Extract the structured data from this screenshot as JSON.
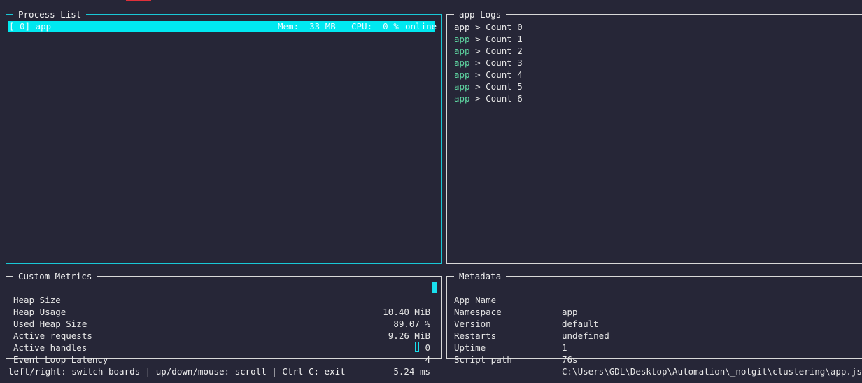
{
  "process_list": {
    "title": "Process List",
    "rows": [
      {
        "id": "[ 0] app",
        "mem": "Mem:  33 MB",
        "cpu": "CPU:  0 %",
        "status": "online"
      }
    ]
  },
  "logs": {
    "title": "app Logs",
    "lines": [
      {
        "app": "app",
        "text": " > Count 0"
      },
      {
        "app": "app",
        "text": " > Count 1"
      },
      {
        "app": "app",
        "text": " > Count 2"
      },
      {
        "app": "app",
        "text": " > Count 3"
      },
      {
        "app": "app",
        "text": " > Count 4"
      },
      {
        "app": "app",
        "text": " > Count 5"
      },
      {
        "app": "app",
        "text": " > Count 6"
      }
    ]
  },
  "metrics": {
    "title": "Custom Metrics",
    "rows": [
      {
        "label": "Heap Size",
        "value": "10.40 MiB"
      },
      {
        "label": "Heap Usage",
        "value": "89.07 %"
      },
      {
        "label": "Used Heap Size",
        "value": "9.26 MiB"
      },
      {
        "label": "Active requests",
        "value": "0"
      },
      {
        "label": "Active handles",
        "value": "4"
      },
      {
        "label": "Event Loop Latency",
        "value": "5.24 ms"
      }
    ]
  },
  "metadata": {
    "title": "Metadata",
    "rows": [
      {
        "key": "App Name",
        "value": "app"
      },
      {
        "key": "Namespace",
        "value": "default"
      },
      {
        "key": "Version",
        "value": "undefined"
      },
      {
        "key": "Restarts",
        "value": "1"
      },
      {
        "key": "Uptime",
        "value": "76s"
      },
      {
        "key": "Script path",
        "value": "C:\\Users\\GDL\\Desktop\\Automation\\_notgit\\clustering\\app.js"
      }
    ]
  },
  "footer": {
    "help": "left/right: switch boards | up/down/mouse: scroll | Ctrl-C: exit"
  },
  "colors": {
    "background": "#262637",
    "accent_cyan": "#00e8f0",
    "log_app_green": "#5fd7a2",
    "top_mark_red": "#e0303a"
  }
}
